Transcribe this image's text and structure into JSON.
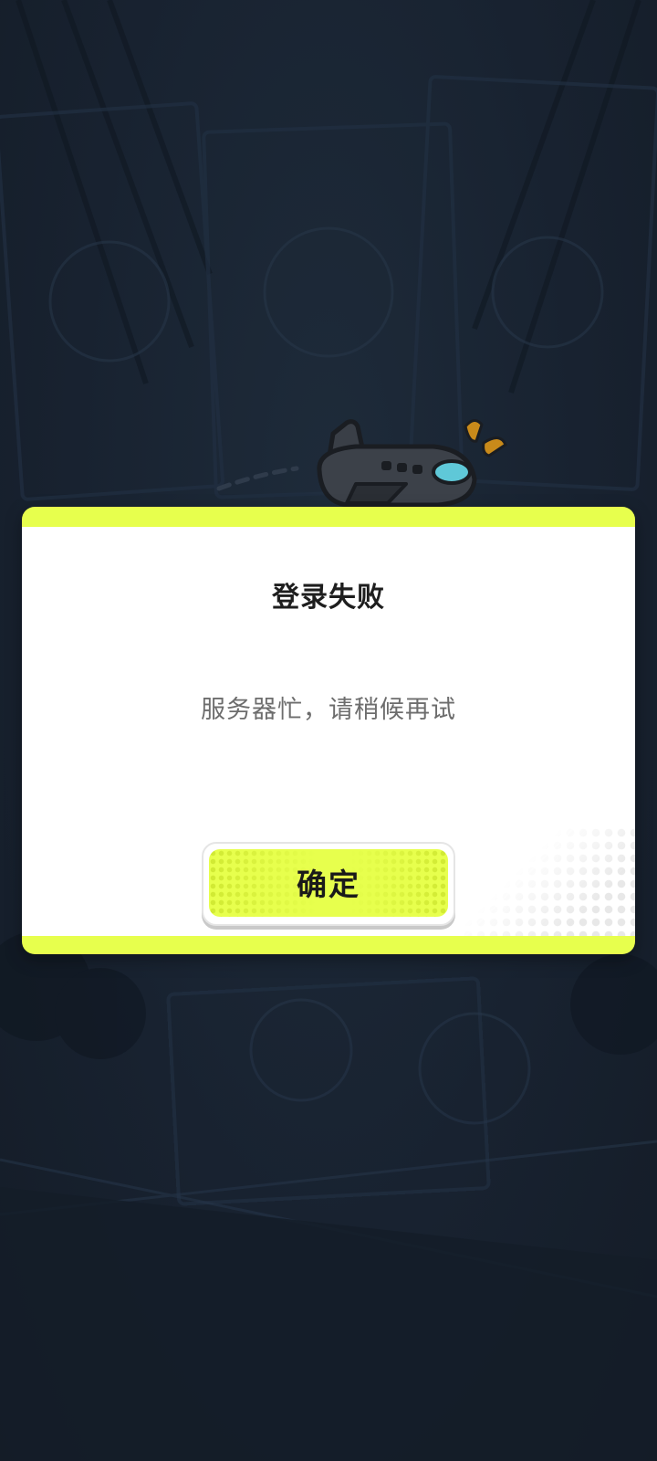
{
  "dialog": {
    "title": "登录失败",
    "message": "服务器忙，请稍候再试",
    "confirm_label": "确定"
  },
  "icons": {
    "mascot": "airplane-mascot-icon"
  },
  "colors": {
    "accent": "#e7ff4d",
    "background": "#16202c",
    "dialog_bg": "#ffffff",
    "title_text": "#1e1e1e",
    "message_text": "#6d6d6d"
  }
}
